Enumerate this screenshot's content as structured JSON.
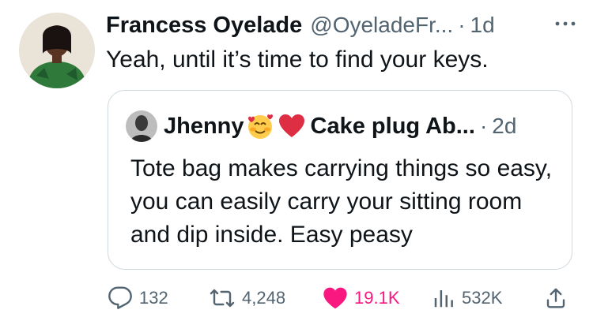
{
  "tweet": {
    "author_name": "Francess Oyelade",
    "handle": "@OyeladeFr...",
    "separator": "·",
    "time": "1d",
    "text": "Yeah, until it’s time to find your keys."
  },
  "quoted_tweet": {
    "author_name": "Jhenny",
    "author_name_suffix": "Cake plug Ab...",
    "separator": "·",
    "time": "2d",
    "text": "Tote bag makes carrying things so easy, you can easily carry your sitting room and dip inside. Easy peasy"
  },
  "actions": {
    "replies": "132",
    "retweets": "4,248",
    "likes": "19.1K",
    "views": "532K"
  },
  "icons": {
    "more": "more-icon",
    "reply": "reply-icon",
    "retweet": "retweet-icon",
    "like": "heart-icon",
    "views": "views-icon",
    "share": "share-icon",
    "emoji_1": "smiling-face-with-hearts-emoji",
    "emoji_2": "red-heart-emoji"
  },
  "colors": {
    "text": "#0f1419",
    "secondary": "#536471",
    "like": "#f91880",
    "border": "#cfd9de"
  }
}
